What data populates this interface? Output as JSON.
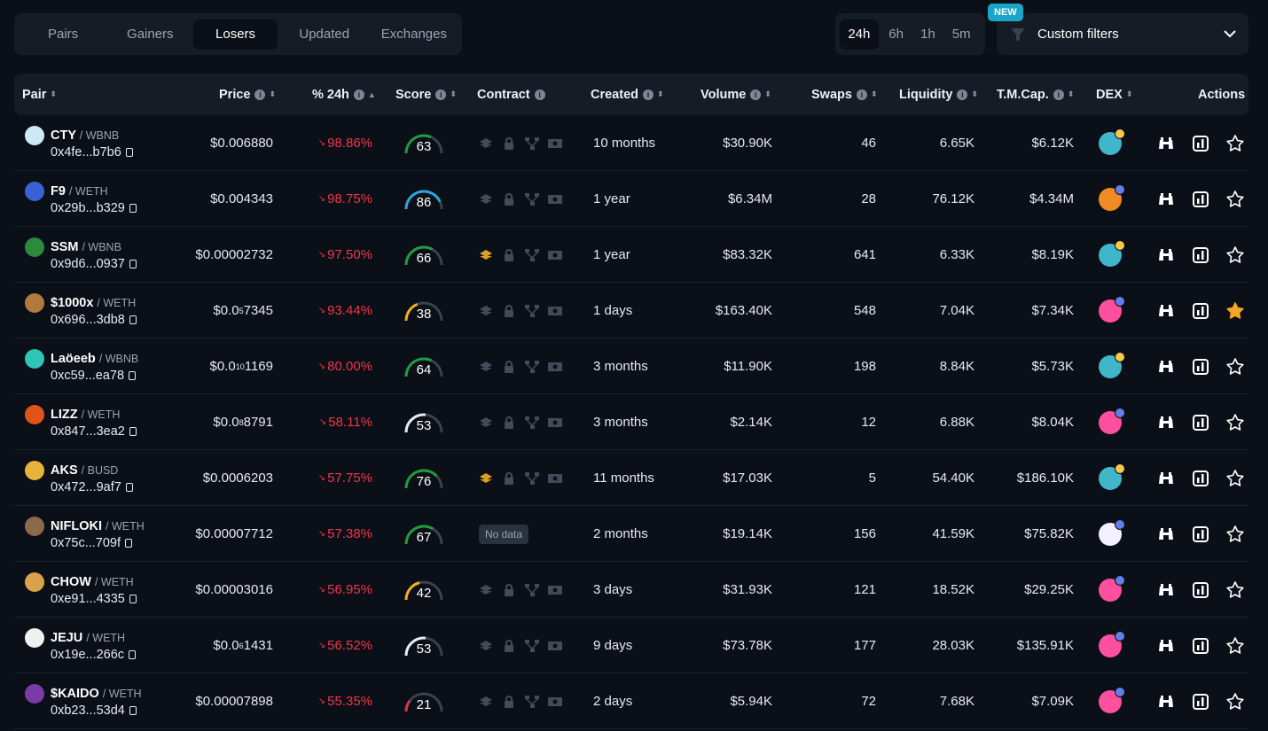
{
  "tabs": [
    {
      "label": "Pairs",
      "active": false
    },
    {
      "label": "Gainers",
      "active": false
    },
    {
      "label": "Losers",
      "active": true
    },
    {
      "label": "Updated",
      "active": false
    },
    {
      "label": "Exchanges",
      "active": false
    }
  ],
  "timeframes": [
    {
      "label": "24h",
      "active": true
    },
    {
      "label": "6h",
      "active": false
    },
    {
      "label": "1h",
      "active": false
    },
    {
      "label": "5m",
      "active": false
    }
  ],
  "custom_filters": {
    "label": "Custom filters",
    "badge": "NEW",
    "icon": "filter-icon"
  },
  "headers": {
    "pair": "Pair",
    "price": "Price",
    "change": "% 24h",
    "score": "Score",
    "contract": "Contract",
    "created": "Created",
    "volume": "Volume",
    "swaps": "Swaps",
    "liquidity": "Liquidity",
    "mcap": "T.M.Cap.",
    "dex": "DEX",
    "actions": "Actions"
  },
  "colors": {
    "negative": "#f0364a",
    "gauge_green": "#1f9d3a",
    "gauge_yellow": "#f2b01e",
    "gauge_blue": "#2aa7d6",
    "gauge_red": "#e0304a",
    "star_fav": "#f5a623",
    "new_badge": "#1aa6c9"
  },
  "rows": [
    {
      "symbol": "CTY",
      "quote": "WBNB",
      "address": "0x4fe...b7b6",
      "price": "$0.006880",
      "change": "98.86%",
      "score": 63,
      "gauge": "green",
      "contract_flagged": false,
      "no_data": false,
      "created": "10 months",
      "volume": "$30.90K",
      "swaps": "46",
      "liquidity": "6.65K",
      "mcap": "$6.12K",
      "dex": "pancakeswap",
      "favorite": false,
      "logo_color": "#cfe8f5"
    },
    {
      "symbol": "F9",
      "quote": "WETH",
      "address": "0x29b...b329",
      "price": "$0.004343",
      "change": "98.75%",
      "score": 86,
      "gauge": "blue",
      "contract_flagged": false,
      "no_data": false,
      "created": "1 year",
      "volume": "$6.34M",
      "swaps": "28",
      "liquidity": "76.12K",
      "mcap": "$4.34M",
      "dex": "shibaswap",
      "favorite": false,
      "logo_color": "#3a62d6"
    },
    {
      "symbol": "SSM",
      "quote": "WBNB",
      "address": "0x9d6...0937",
      "price": "$0.00002732",
      "change": "97.50%",
      "score": 66,
      "gauge": "green",
      "contract_flagged": true,
      "no_data": false,
      "created": "1 year",
      "volume": "$83.32K",
      "swaps": "641",
      "liquidity": "6.33K",
      "mcap": "$8.19K",
      "dex": "pancakeswap",
      "favorite": false,
      "logo_color": "#2c8a3b"
    },
    {
      "symbol": "$1000x",
      "quote": "WETH",
      "address": "0x696...3db8",
      "price_main": "$0.0",
      "price_sub": "5",
      "price_tail": "7345",
      "change": "93.44%",
      "score": 38,
      "gauge": "yellow",
      "contract_flagged": false,
      "no_data": false,
      "created": "1 days",
      "volume": "$163.40K",
      "swaps": "548",
      "liquidity": "7.04K",
      "mcap": "$7.34K",
      "dex": "uniswap",
      "favorite": true,
      "logo_color": "#b07a3c"
    },
    {
      "symbol": "Laöeeb",
      "quote": "WBNB",
      "address": "0xc59...ea78",
      "price_main": "$0.0",
      "price_sub": "10",
      "price_tail": "1169",
      "change": "80.00%",
      "score": 64,
      "gauge": "green",
      "contract_flagged": false,
      "no_data": false,
      "created": "3 months",
      "volume": "$11.90K",
      "swaps": "198",
      "liquidity": "8.84K",
      "mcap": "$5.73K",
      "dex": "pancakeswap",
      "favorite": false,
      "logo_color": "#2ec4b6"
    },
    {
      "symbol": "LIZZ",
      "quote": "WETH",
      "address": "0x847...3ea2",
      "price_main": "$0.0",
      "price_sub": "8",
      "price_tail": "8791",
      "change": "58.11%",
      "score": 53,
      "gauge": "white",
      "contract_flagged": false,
      "no_data": false,
      "created": "3 months",
      "volume": "$2.14K",
      "swaps": "12",
      "liquidity": "6.88K",
      "mcap": "$8.04K",
      "dex": "uniswap",
      "favorite": false,
      "logo_color": "#e2531a"
    },
    {
      "symbol": "AKS",
      "quote": "BUSD",
      "address": "0x472...9af7",
      "price": "$0.0006203",
      "change": "57.75%",
      "score": 76,
      "gauge": "green",
      "contract_flagged": true,
      "no_data": false,
      "created": "11 months",
      "volume": "$17.03K",
      "swaps": "5",
      "liquidity": "54.40K",
      "mcap": "$186.10K",
      "dex": "pancakeswap",
      "favorite": false,
      "logo_color": "#e8b33a"
    },
    {
      "symbol": "NIFLOKI",
      "quote": "WETH",
      "address": "0x75c...709f",
      "price": "$0.00007712",
      "change": "57.38%",
      "score": 67,
      "gauge": "green",
      "contract_flagged": false,
      "no_data": true,
      "no_data_label": "No data",
      "created": "2 months",
      "volume": "$19.14K",
      "swaps": "156",
      "liquidity": "41.59K",
      "mcap": "$75.82K",
      "dex": "other",
      "favorite": false,
      "logo_color": "#8a6a4a"
    },
    {
      "symbol": "CHOW",
      "quote": "WETH",
      "address": "0xe91...4335",
      "price": "$0.00003016",
      "change": "56.95%",
      "score": 42,
      "gauge": "yellow",
      "contract_flagged": false,
      "no_data": false,
      "created": "3 days",
      "volume": "$31.93K",
      "swaps": "121",
      "liquidity": "18.52K",
      "mcap": "$29.25K",
      "dex": "uniswap",
      "favorite": false,
      "logo_color": "#d9a34a"
    },
    {
      "symbol": "JEJU",
      "quote": "WETH",
      "address": "0x19e...266c",
      "price_main": "$0.0",
      "price_sub": "6",
      "price_tail": "1431",
      "change": "56.52%",
      "score": 53,
      "gauge": "white",
      "contract_flagged": false,
      "no_data": false,
      "created": "9 days",
      "volume": "$73.78K",
      "swaps": "177",
      "liquidity": "28.03K",
      "mcap": "$135.91K",
      "dex": "uniswap",
      "favorite": false,
      "logo_color": "#f0f0f0"
    },
    {
      "symbol": "$KAIDO",
      "quote": "WETH",
      "address": "0xb23...53d4",
      "price": "$0.00007898",
      "change": "55.35%",
      "score": 21,
      "gauge": "red",
      "contract_flagged": false,
      "no_data": false,
      "created": "2 days",
      "volume": "$5.94K",
      "swaps": "72",
      "liquidity": "7.68K",
      "mcap": "$7.09K",
      "dex": "uniswap",
      "favorite": false,
      "logo_color": "#7a3aa8"
    }
  ]
}
